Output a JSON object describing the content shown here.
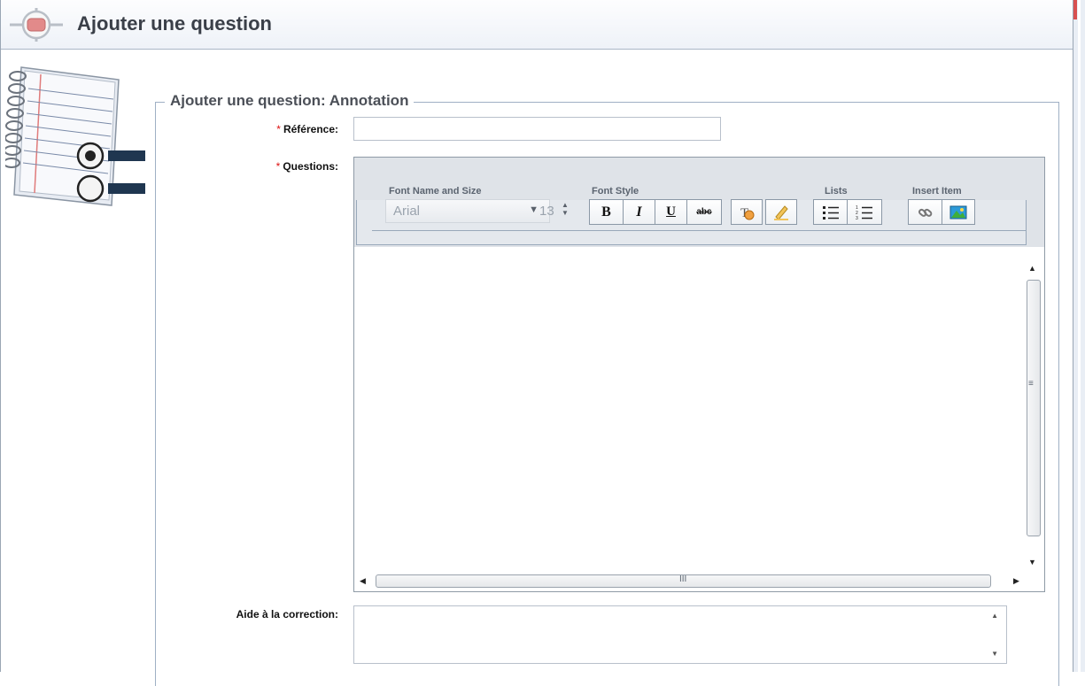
{
  "header": {
    "title": "Ajouter une question"
  },
  "form": {
    "legend": "Ajouter une question: Annotation",
    "required_mark": "*",
    "reference": {
      "label": "Référence:",
      "value": ""
    },
    "questions": {
      "label": "Questions:"
    },
    "aide": {
      "label": "Aide à la correction:",
      "value": ""
    }
  },
  "toolbar": {
    "font_group_label": "Font Name and Size",
    "font_name": "Arial",
    "font_size": "13",
    "style_group_label": "Font Style",
    "bold": "B",
    "italic": "I",
    "underline": "U",
    "strike": "abc",
    "lists_group_label": "Lists",
    "insert_group_label": "Insert Item"
  },
  "scrollbars": {
    "h_grip": "III",
    "v_grip": "≡"
  },
  "colors": {
    "accent_red": "#d85050",
    "border_blue": "#9fb0c4"
  },
  "icons": [
    "target-icon",
    "notebook-icon",
    "clear-format-icon",
    "highlighter-icon",
    "bullet-list-icon",
    "numbered-list-icon",
    "link-icon",
    "image-icon"
  ]
}
